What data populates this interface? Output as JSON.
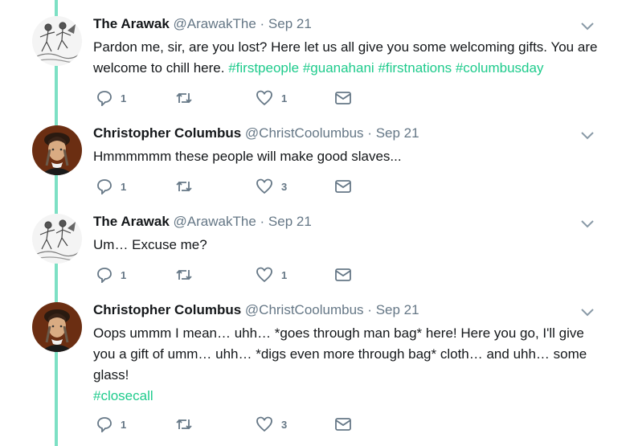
{
  "tweets": [
    {
      "name": "The Arawak",
      "handle": "@ArawakThe",
      "separator": "·",
      "date": "Sep 21",
      "avatar": "arawak-engraving-avatar",
      "text": "Pardon me, sir, are you lost? Here let us all give you some welcoming gifts. You are welcome to chill here.",
      "hashtags": [
        "#firstpeople",
        "#guanahani",
        "#firstnations",
        "#columbusday"
      ],
      "replies": "1",
      "retweets": "",
      "likes": "1"
    },
    {
      "name": "Christopher Columbus",
      "handle": "@ChristCoolumbus",
      "separator": "·",
      "date": "Sep 21",
      "avatar": "columbus-portrait-avatar",
      "text": "Hmmmmmm these people will make good slaves...",
      "hashtags": [],
      "replies": "1",
      "retweets": "",
      "likes": "3"
    },
    {
      "name": "The Arawak",
      "handle": "@ArawakThe",
      "separator": "·",
      "date": "Sep 21",
      "avatar": "arawak-engraving-avatar",
      "text": "Um… Excuse me?",
      "hashtags": [],
      "replies": "1",
      "retweets": "",
      "likes": "1"
    },
    {
      "name": "Christopher Columbus",
      "handle": "@ChristCoolumbus",
      "separator": "·",
      "date": "Sep 21",
      "avatar": "columbus-portrait-avatar",
      "text": "Oops ummm I mean… uhh… *goes through man bag* here! Here you go, I'll give you a gift of umm… uhh… *digs even more through bag* cloth… and uhh… some glass!",
      "hashtags": [
        "#closecall"
      ],
      "replies": "1",
      "retweets": "",
      "likes": "3"
    }
  ],
  "colors": {
    "thread_line": "#7de0c4",
    "hashtag": "#1ecb8c",
    "muted": "#657786",
    "text": "#14171a"
  },
  "icons": [
    "reply-icon",
    "retweet-icon",
    "like-icon",
    "direct-message-icon",
    "chevron-down-icon"
  ]
}
